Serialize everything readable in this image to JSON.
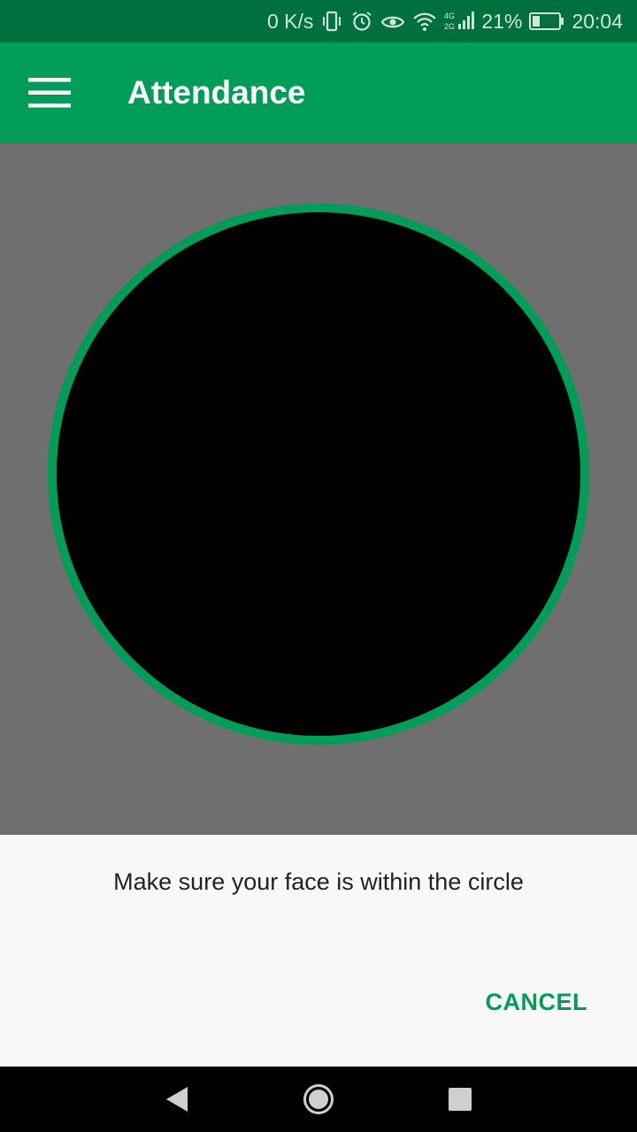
{
  "status_bar": {
    "network_speed": "0 K/s",
    "battery_percent": "21%",
    "time": "20:04",
    "icons": [
      "vibrate-icon",
      "alarm-icon",
      "eye-icon",
      "wifi-icon",
      "signal-icon",
      "battery-icon"
    ]
  },
  "app_bar": {
    "title": "Attendance",
    "menu_icon": "hamburger-menu-icon"
  },
  "camera": {
    "ring_color": "#009d58"
  },
  "dialog": {
    "message": "Make sure your face is within the circle",
    "cancel_label": "CANCEL"
  },
  "nav_bar": {
    "buttons": [
      "back-icon",
      "home-icon",
      "recents-icon"
    ]
  },
  "colors": {
    "primary": "#009d58",
    "primary_dark": "#00703f",
    "overlay": "#6f6f6f"
  }
}
